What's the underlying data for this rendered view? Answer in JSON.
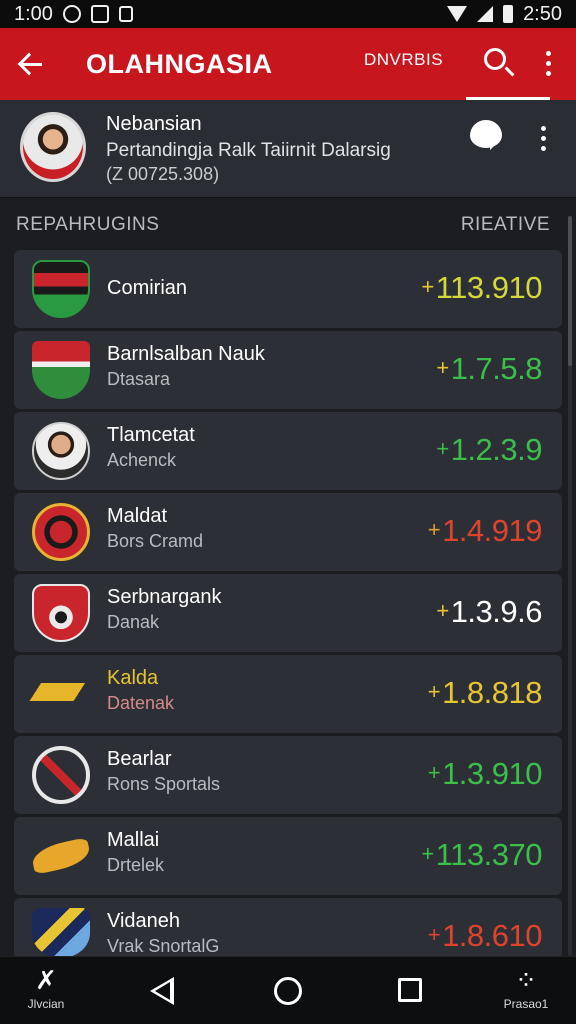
{
  "status": {
    "time": "1:00",
    "clock_right": "2:50"
  },
  "appbar": {
    "title": "OLAHNGASIA",
    "tab": "DNVRBIS"
  },
  "profile": {
    "name": "Nebansian",
    "subtitle": "Pertandingja Ralk Taiirnit Dalarsig",
    "id_line": "(Z 00725.308)"
  },
  "section": {
    "left_header": "REPAHRUGINS",
    "right_header": "RIEATIVE"
  },
  "colors": {
    "appbar": "#c8161e",
    "up": "#3cbf4a",
    "yellow": "#e7c532",
    "red": "#e0432c",
    "white": "#ffffff",
    "orange": "#e79a2a"
  },
  "rows": [
    {
      "name": "Comirian",
      "sub": "",
      "prefix": "+",
      "value": "113.910",
      "prefix_color": "#e7c532",
      "value_color": "#d4d83a",
      "logo": "shield-crest-icon"
    },
    {
      "name": "Barnlsalban Nauk",
      "sub": "Dtasara",
      "prefix": "+",
      "value": "1.7.5.8",
      "prefix_color": "#e7c532",
      "value_color": "#3cbf4a",
      "value_end_color": "#e0432c",
      "logo": "flag-crest-icon"
    },
    {
      "name": "Tlamcetat",
      "sub": "Achenck",
      "prefix": "+",
      "value": "1.2.3.9",
      "prefix_color": "#3cbf4a",
      "value_color": "#3cbf4a",
      "logo": "player-avatar-icon"
    },
    {
      "name": "Maldat",
      "sub": "Bors Cramd",
      "prefix": "+",
      "value": "1.4.919",
      "prefix_color": "#e79a2a",
      "value_color": "#e0432c",
      "logo": "round-crest-icon"
    },
    {
      "name": "Serbnargank",
      "sub": "Danak",
      "prefix": "+",
      "value": "1.3.9.6",
      "prefix_color": "#e7c532",
      "value_color": "#ffffff",
      "logo": "badge-crest-icon"
    },
    {
      "name": "Kalda",
      "sub": "Datenak",
      "prefix": "+",
      "value": "1.8.818",
      "prefix_color": "#e7c532",
      "value_color": "#e7c532",
      "logo": "swoosh-logo-icon"
    },
    {
      "name": "Bearlar",
      "sub": "Rons Sportals",
      "prefix": "+",
      "value": "1.3.910",
      "prefix_color": "#3cbf4a",
      "value_color": "#3cbf4a",
      "logo": "circle-x-logo-icon"
    },
    {
      "name": "Mallai",
      "sub": "Drtelek",
      "prefix": "+",
      "value": "113.370",
      "prefix_color": "#3cbf4a",
      "value_color": "#3cbf4a",
      "logo": "bird-logo-icon"
    },
    {
      "name": "Vidaneh",
      "sub": "Vrak SnortalG",
      "prefix": "+",
      "value": "1.8.610",
      "prefix_color": "#e0432c",
      "value_color": "#e0432c",
      "value_end_color": "#e7c532",
      "logo": "striped-shield-icon"
    }
  ],
  "bottom_nav": {
    "left_label": "Jlvcian",
    "right_label": "Prasao1"
  }
}
